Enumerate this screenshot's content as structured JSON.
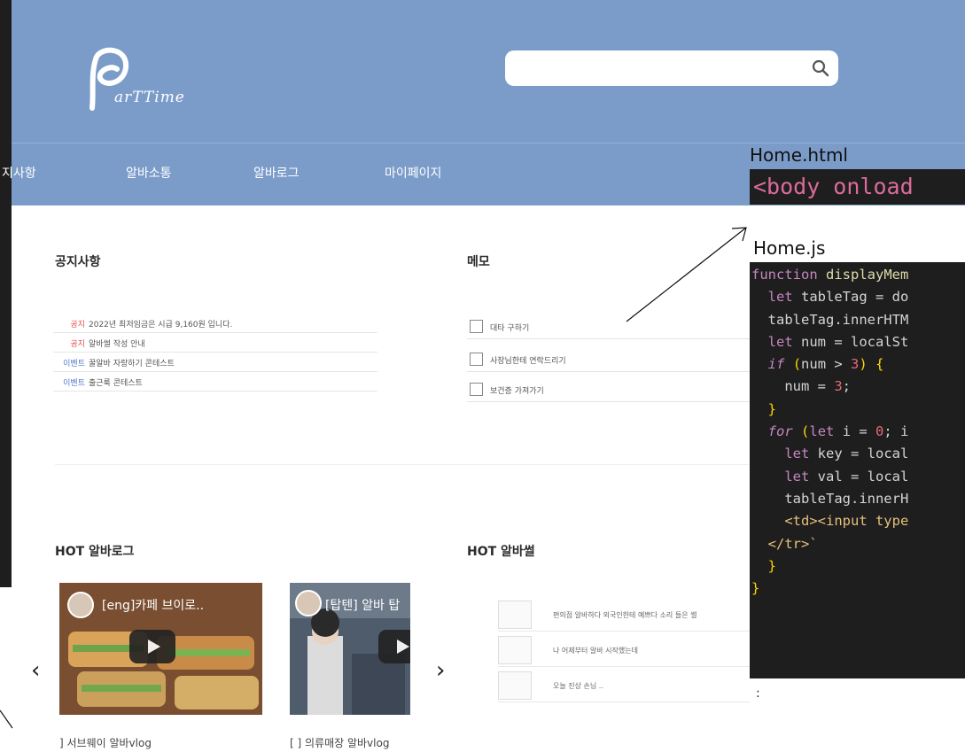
{
  "header": {
    "logo_text": "arTTime",
    "search_placeholder": ""
  },
  "nav": {
    "notice": "지사항",
    "community": "알바소통",
    "albalog": "알바로그",
    "mypage": "마이페이지"
  },
  "notice": {
    "title": "공지사항",
    "rows": [
      {
        "tag": "공지",
        "text": "2022년 최저임금은 시급 9,160원 입니다."
      },
      {
        "tag": "공지",
        "text": "알바썰 작성 안내"
      },
      {
        "tag": "이벤트",
        "text": "꿀알바 자랑하기 콘테스트"
      },
      {
        "tag": "이벤트",
        "text": "출근룩 콘테스트"
      }
    ]
  },
  "memo": {
    "title": "메모",
    "items": [
      "대타 구하기",
      "사장님한테 연락드리기",
      "보건증 가져가기"
    ]
  },
  "hot_albalog": {
    "title": "HOT 알바로그",
    "videos": [
      {
        "title": "[eng]카페 브이로..",
        "caption": "] 서브웨이 알바vlog"
      },
      {
        "title": "[탑텐] 알바 탑",
        "caption": "[ ] 의류매장 알바vlog"
      }
    ]
  },
  "hot_albasseol": {
    "title": "HOT 알바썰",
    "rows": [
      "편의점 알바하다 외국인한테 예쁘다 소리 들은 썰",
      "나 어제부터 알바 시작했는데",
      "오늘 진상 손님 .."
    ]
  },
  "overlay": {
    "html_file": "Home.html",
    "html_code": "<body onload",
    "js_file": "Home.js",
    "trailing": ":"
  },
  "colors": {
    "header_bg": "#7b9cc9",
    "code_bg": "#1e1e1e"
  }
}
